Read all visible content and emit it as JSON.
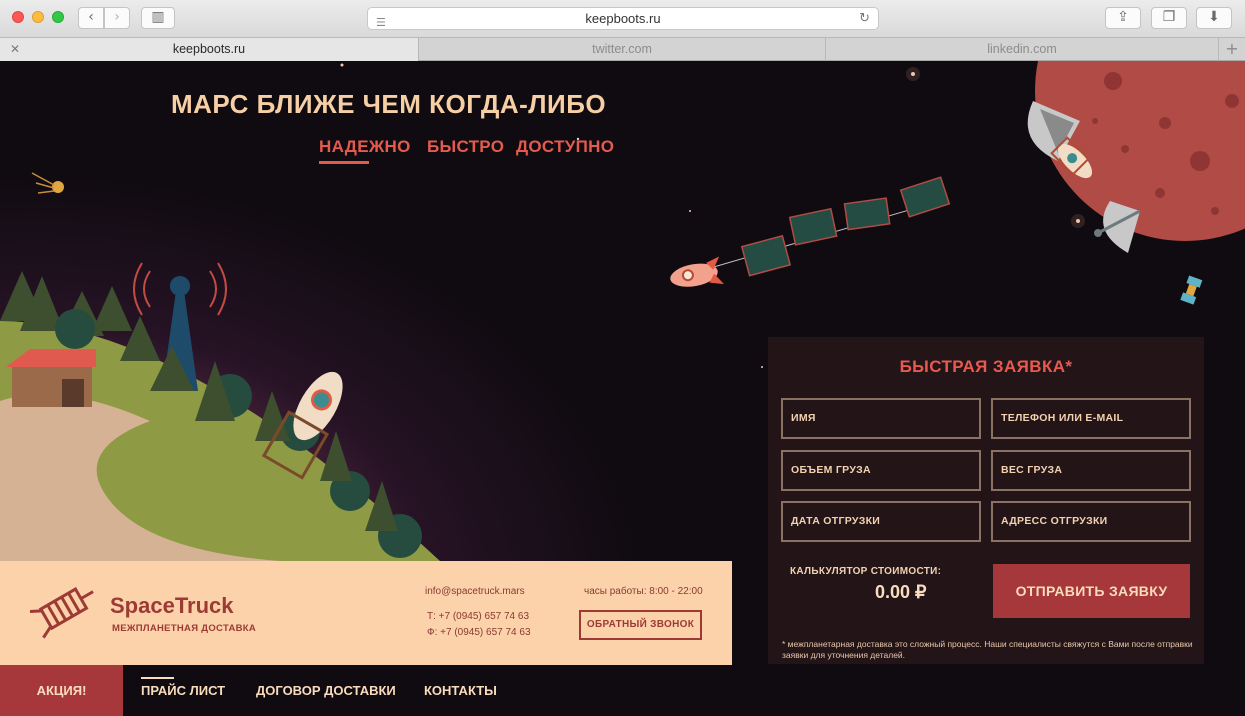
{
  "browser": {
    "url": "keepboots.ru",
    "tabs": [
      {
        "label": "keepboots.ru",
        "active": true
      },
      {
        "label": "twitter.com",
        "active": false
      },
      {
        "label": "linkedin.com",
        "active": false
      }
    ]
  },
  "hero": {
    "title": "МАРС БЛИЖЕ ЧЕМ КОГДА-ЛИБО",
    "taglines": [
      "НАДЕЖНО",
      "БЫСТРО",
      "ДОСТУПНО"
    ]
  },
  "form": {
    "title": "БЫСТРАЯ ЗАЯВКА*",
    "fields": {
      "name": "ИМЯ",
      "contact": "ТЕЛЕФОН ИЛИ E-MAIL",
      "volume": "ОБЪЕМ ГРУЗА",
      "weight": "ВЕС ГРУЗА",
      "date": "ДАТА ОТГРУЗКИ",
      "address": "АДРЕСС ОТГРУЗКИ"
    },
    "calculator_label": "КАЛЬКУЛЯТОР СТОИМОСТИ:",
    "calculator_value": "0.00 ₽",
    "submit_label": "ОТПРАВИТЬ ЗАЯВКУ",
    "disclaimer": "* межпланетарная доставка это сложный процесс. Наши специалисты свяжутся с Вами после отправки заявки для уточнения деталей."
  },
  "info": {
    "brand_name": "SpaceTruck",
    "brand_tagline": "МЕЖПЛАНЕТНАЯ ДОСТАВКА",
    "email": "info@spacetruck.mars",
    "phone": "Т:  +7 (0945) 657 74 63",
    "fax": "Ф: +7 (0945) 657 74 63",
    "hours": "часы работы: 8:00 - 22:00",
    "callback_label": "ОБРАТНЫЙ ЗВОНОК"
  },
  "nav": {
    "promo": "АКЦИЯ!",
    "items": [
      "ПРАЙС ЛИСТ",
      "ДОГОВОР ДОСТАВКИ",
      "КОНТАКТЫ"
    ]
  },
  "colors": {
    "accent": "#e55a4f",
    "brand_red": "#a6383b",
    "cream": "#fbd2aa",
    "background": "#0f0b10"
  }
}
